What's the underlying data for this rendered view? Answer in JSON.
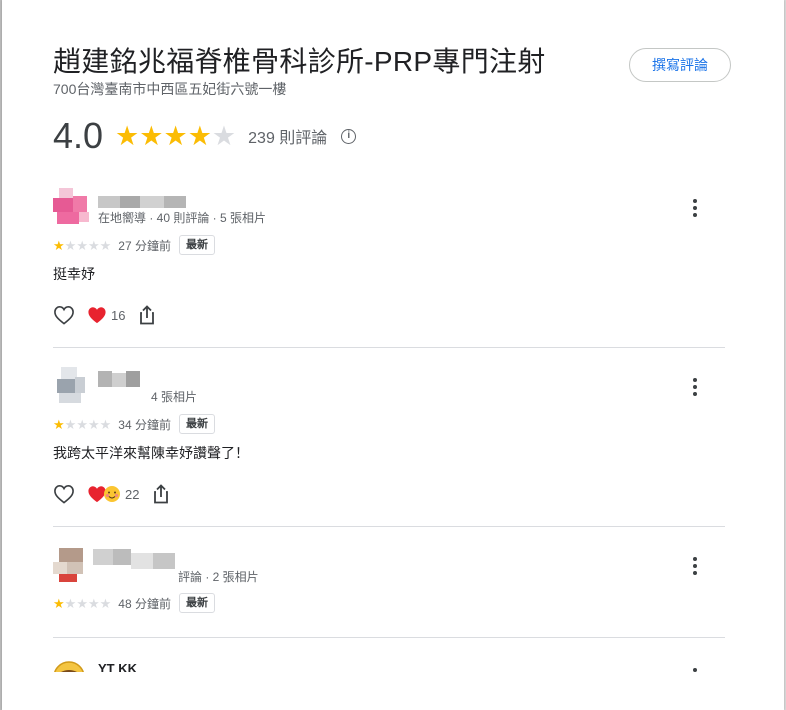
{
  "place": {
    "title": "趙建銘兆福脊椎骨科診所-PRP專門注射",
    "address": "700台灣臺南市中西區五妃街六號一樓",
    "write_review_label": "撰寫評論",
    "rating": "4.0",
    "rating_value": 4.0,
    "review_count_label": "239 則評論",
    "info_icon": "info-icon"
  },
  "reviews": [
    {
      "meta": "在地嚮導 · 40 則評論 · 5 張相片",
      "rating": 1,
      "time": "27 分鐘前",
      "badge": "最新",
      "text": "挺幸妤",
      "reaction_count": "16",
      "reactions": [
        "red-heart-icon"
      ]
    },
    {
      "meta": "4 張相片",
      "rating": 1,
      "time": "34 分鐘前",
      "badge": "最新",
      "text": "我跨太平洋來幫陳幸妤讚聲了！",
      "reaction_count": "22",
      "reactions": [
        "red-heart-icon",
        "blushing-face-icon"
      ]
    },
    {
      "meta": "評論 · 2 張相片",
      "rating": 1,
      "time": "48 分鐘前",
      "badge": "最新",
      "text": "",
      "reaction_count": "",
      "reactions": []
    },
    {
      "name": "YT KK"
    }
  ],
  "colors": {
    "accent": "#1a73e8",
    "star": "#fbbc04",
    "star_empty": "#dadce0",
    "heart": "#e8232f"
  }
}
